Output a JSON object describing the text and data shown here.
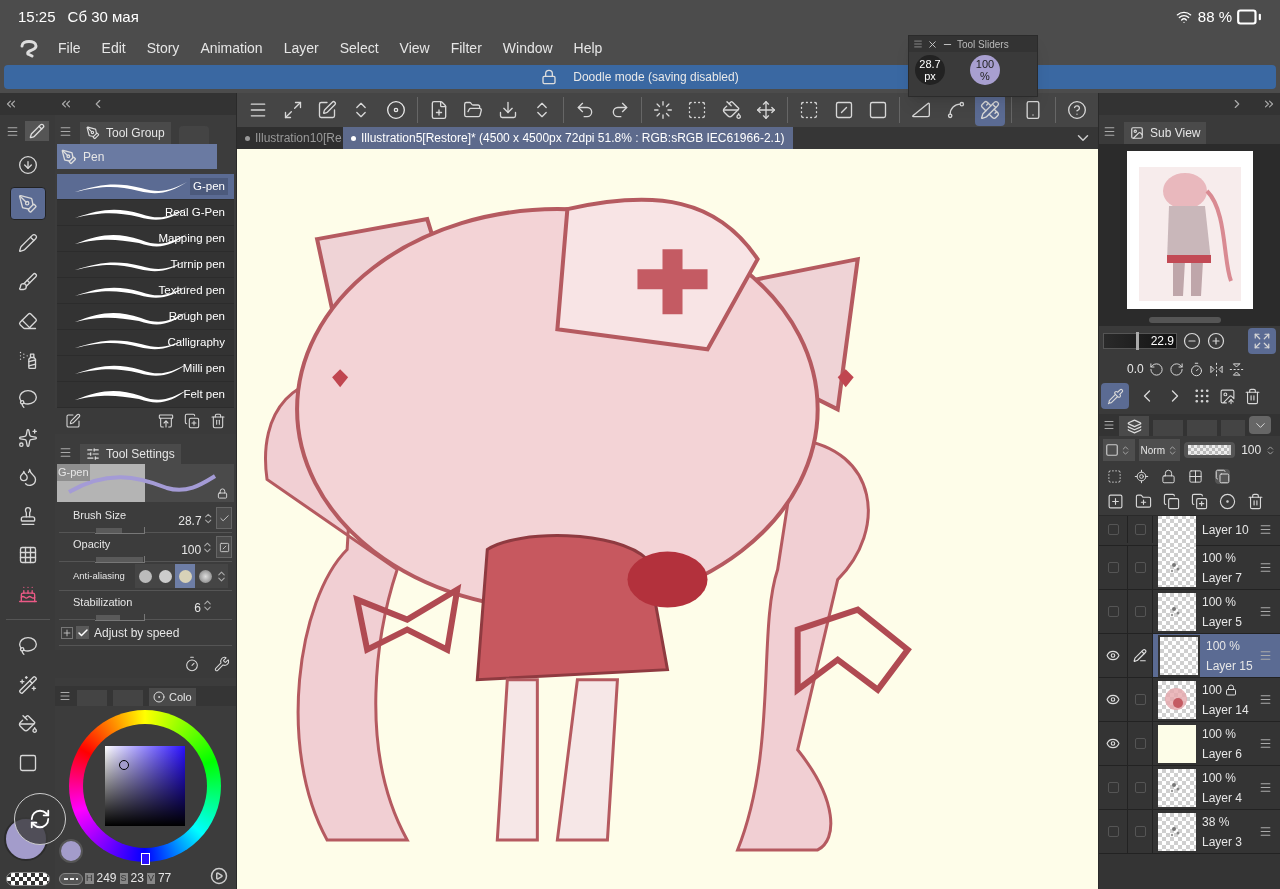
{
  "status_bar": {
    "time": "15:25",
    "date": "Сб 30 мая",
    "battery": "88 %"
  },
  "menu": [
    "File",
    "Edit",
    "Story",
    "Animation",
    "Layer",
    "Select",
    "View",
    "Filter",
    "Window",
    "Help"
  ],
  "banner": {
    "text": "Doodle mode (saving disabled)"
  },
  "tool_sliders": {
    "title": "Tool Sliders",
    "size_value": "28.7",
    "size_unit": "px",
    "opacity_value": "100",
    "opacity_unit": "%"
  },
  "canvas_toolbar": [
    {
      "selected": false
    },
    {
      "selected": false
    },
    {
      "selected": false
    },
    {
      "selected": false
    },
    {
      "selected": false
    },
    {
      "selected": false
    },
    {
      "selected": false
    },
    {
      "selected": false
    },
    {
      "selected": false
    },
    {
      "selected": false
    },
    {
      "selected": false
    },
    {
      "selected": false
    },
    {
      "selected": false
    },
    {
      "selected": false
    },
    {
      "selected": false
    },
    {
      "selected": false
    },
    {
      "selected": false
    },
    {
      "selected": false
    },
    {
      "selected": false
    },
    {
      "selected": false
    },
    {
      "selected": true
    },
    {
      "selected": false
    },
    {
      "selected": false
    }
  ],
  "document_tabs": [
    {
      "label": "Illustration10[Re",
      "selected": false
    },
    {
      "label": "Illustration5[Restore]* (4500 x 4500px 72dpi 51.8% : RGB:sRGB IEC61966-2.1)",
      "selected": true
    }
  ],
  "tools": [
    {
      "selected": false
    },
    {
      "selected": true
    },
    {
      "selected": false
    },
    {
      "selected": false
    },
    {
      "selected": false
    },
    {
      "selected": false
    },
    {
      "selected": false
    },
    {
      "selected": false
    },
    {
      "selected": false
    },
    {
      "selected": false
    },
    {
      "selected": false
    },
    {
      "selected": false
    },
    {
      "selected": false
    },
    {
      "selected": false
    },
    {
      "selected": false
    },
    {
      "selected": false
    }
  ],
  "tool_group": {
    "tab": "Tool Group",
    "group": "Pen",
    "sub_tools": [
      {
        "label": "G-pen",
        "selected": true
      },
      {
        "label": "Real G-Pen",
        "selected": false
      },
      {
        "label": "Mapping pen",
        "selected": false
      },
      {
        "label": "Turnip pen",
        "selected": false
      },
      {
        "label": "Textured pen",
        "selected": false
      },
      {
        "label": "Rough pen",
        "selected": false
      },
      {
        "label": "Calligraphy",
        "selected": false
      },
      {
        "label": "Milli pen",
        "selected": false
      },
      {
        "label": "Felt pen",
        "selected": false
      }
    ]
  },
  "tool_settings": {
    "tab": "Tool Settings",
    "preview_label": "G-pen",
    "rows": [
      {
        "kind": "slider",
        "label": "Brush Size",
        "value": "28.7",
        "level": 0.55
      },
      {
        "kind": "slider",
        "label": "Opacity",
        "value": "100",
        "level": 1
      },
      {
        "kind": "options",
        "label": "Anti-aliasing",
        "options": [
          {
            "selected": false
          },
          {
            "selected": false
          },
          {
            "selected": true
          },
          {
            "selected": false
          }
        ]
      },
      {
        "kind": "slider",
        "label": "Stabilization",
        "value": "6",
        "level": 0.5
      }
    ],
    "adjust_by_speed": {
      "label": "Adjust by speed",
      "checked": true
    }
  },
  "color_panel": {
    "tab": "Colo",
    "h_label": "H",
    "h": "249",
    "s_label": "S",
    "s": "23",
    "v_label": "V",
    "v": "77"
  },
  "sub_view": {
    "tab": "Sub View",
    "zoom": "22.9",
    "zoom_slider": {
      "level": 0.45
    },
    "rotation": "0.0"
  },
  "layer_props": {
    "blend": "Norm",
    "opacity": "100",
    "opacity_slider": {
      "level": 1
    }
  },
  "layers": [
    {
      "name": "Layer 10",
      "visible": false,
      "editing": false,
      "selected": false,
      "thumbnail": {
        "kind": "blank"
      }
    },
    {
      "name": "Layer 7",
      "opacity": "100 %",
      "visible": false,
      "editing": false,
      "selected": false,
      "alpha_locked": false,
      "thumbnail": {
        "kind": "sketch"
      }
    },
    {
      "name": "Layer 5",
      "opacity": "100 %",
      "visible": false,
      "editing": false,
      "selected": false,
      "alpha_locked": false,
      "thumbnail": {
        "kind": "sketch"
      }
    },
    {
      "name": "Layer 15",
      "opacity": "100 %",
      "visible": true,
      "editing": true,
      "selected": true,
      "alpha_locked": false,
      "thumbnail": {
        "kind": "blank"
      }
    },
    {
      "name": "Layer 14",
      "opacity": "100",
      "visible": true,
      "editing": false,
      "selected": false,
      "alpha_locked": true,
      "thumbnail": {
        "kind": "pink"
      }
    },
    {
      "name": "Layer 6",
      "opacity": "100 %",
      "visible": true,
      "editing": false,
      "selected": false,
      "alpha_locked": false,
      "thumbnail": {
        "kind": "cream"
      }
    },
    {
      "name": "Layer 4",
      "opacity": "100 %",
      "visible": false,
      "editing": false,
      "selected": false,
      "alpha_locked": false,
      "thumbnail": {
        "kind": "sketch"
      }
    },
    {
      "name": "Layer 3",
      "opacity": "38 %",
      "visible": false,
      "editing": false,
      "selected": false,
      "alpha_locked": false,
      "thumbnail": {
        "kind": "sketch"
      }
    }
  ]
}
